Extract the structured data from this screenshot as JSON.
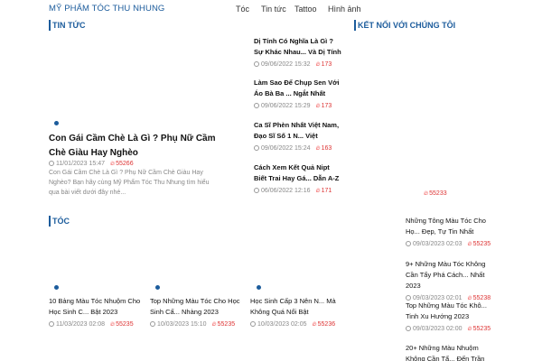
{
  "header": {
    "brand": "MỸ PHẨM TÓC THU NHUNG",
    "nav": [
      "Tóc",
      "Tin tức",
      "Tattoo",
      "Hình ảnh"
    ]
  },
  "sections": {
    "tin_tuc": "TIN TỨC",
    "ket_noi": "KẾT NỐI VỚI CHÚNG TÔI",
    "toc": "TÓC"
  },
  "featured": {
    "title": "Con Gái Cầm Chè Là Gì ? Phụ Nữ Cầm Chè Giàu Hay Nghèo",
    "date": "11/01/2023 15:47",
    "views": "55266",
    "excerpt": "Con Gái Cầm Chè Là Gì ? Phụ Nữ Cầm Chè Giàu Hay Nghèo? Bạn hãy cùng Mỹ Phẩm Tóc Thu Nhung tìm hiểu qua bài viết dưới đây nhé..."
  },
  "side_news": [
    {
      "title": "Dị Tính Có Nghĩa Là Gì ? Sự Khác Nhau... Và Dị Tính",
      "date": "09/06/2022 15:32",
      "views": "173"
    },
    {
      "title": "Làm Sao Để Chụp Sen Với Áo Bà Ba ... Ngắt Nhất",
      "date": "09/06/2022 15:29",
      "views": "173"
    },
    {
      "title": "Ca Sĩ Phèn Nhất Việt Nam, Đạo Sĩ Số 1 N... Việt",
      "date": "09/06/2022 15:24",
      "views": "163"
    },
    {
      "title": "Cách Xem Kết Quả Nipt Biết Trai Hay Gá... Dẫn A-Z",
      "date": "06/06/2022 12:16",
      "views": "171"
    }
  ],
  "ket_noi_views": "55233",
  "toc_cards": [
    {
      "title": "10 Bảng Màu Tóc Nhuộm Cho Học Sinh C... Bật 2023",
      "date": "11/03/2023 02:08",
      "views": "55235"
    },
    {
      "title": "Top Những Màu Tóc Cho Học Sinh Cấ... Nhàng 2023",
      "date": "10/03/2023 15:10",
      "views": "55235"
    },
    {
      "title": "Học Sinh Cấp 3 Nên N... Mà Không Quá Nổi Bật",
      "date": "10/03/2023 02:05",
      "views": "55236"
    }
  ],
  "right_list": [
    {
      "title": "Những Tông Màu Tóc Cho Họ... Đẹp, Tự Tin Nhất",
      "date": "09/03/2023 02:03",
      "views": "55235"
    },
    {
      "title": "9+ Những Màu Tóc Không Cần Tẩy Phá Cách... Nhất 2023",
      "date": "09/03/2023 02:01",
      "views": "55238"
    },
    {
      "title": "Top Những Màu Tóc Khô... Tinh Xu Hướng 2023",
      "date": "09/03/2023 02:00",
      "views": "55235"
    },
    {
      "title": "20+ Những Màu Nhuộm Không Cần Tẩ... Đến Trần",
      "date": "",
      "views": ""
    }
  ],
  "colors": {
    "accent": "#1c5c9c",
    "views": "#dd3333"
  }
}
